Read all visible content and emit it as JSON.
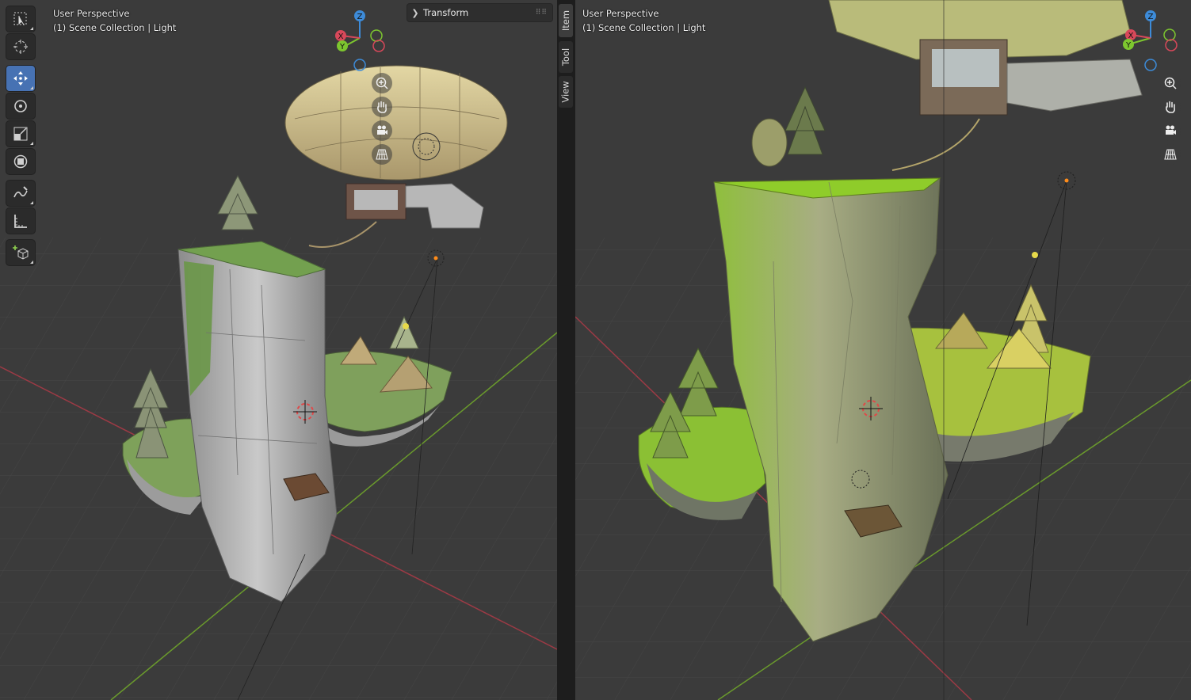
{
  "left_viewport": {
    "view_name": "User Perspective",
    "collection": "(1) Scene Collection | Light",
    "transform_panel_label": "Transform"
  },
  "right_viewport": {
    "view_name": "User Perspective",
    "collection": "(1) Scene Collection | Light"
  },
  "sidebar_tabs": [
    "Item",
    "Tool",
    "View"
  ],
  "gizmo": {
    "z": "Z",
    "y": "Y",
    "x": "X"
  },
  "colors": {
    "accent": "#4772b3",
    "x_axis": "#d8485a",
    "y_axis": "#7dc62f",
    "z_axis": "#3d8bd8"
  }
}
